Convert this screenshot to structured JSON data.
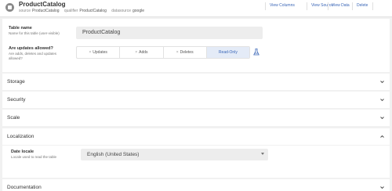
{
  "header": {
    "title": "ProductCatalog",
    "meta": [
      {
        "label": "source",
        "value": "ProductCatalog"
      },
      {
        "label": "qualifier",
        "value": "ProductCatalog"
      },
      {
        "label": "datasource",
        "value": "google"
      }
    ],
    "actions": [
      "View Columns",
      "View Source",
      "View Data",
      "Delete"
    ]
  },
  "form": {
    "table_name": {
      "label": "Table name",
      "sublabel": "Name for this table (user-visible)",
      "value": "ProductCatalog"
    },
    "updates": {
      "label": "Are updates allowed?",
      "sublabel_line1": "Are adds, deletes and updates",
      "sublabel_line2": "allowed?",
      "options": [
        {
          "label": "Updates",
          "active": false
        },
        {
          "label": "Adds",
          "active": false
        },
        {
          "label": "Deletes",
          "active": false
        },
        {
          "label": "Read-Only",
          "active": true
        }
      ]
    }
  },
  "sections": {
    "storage": "Storage",
    "security": "Security",
    "scale": "Scale",
    "localization": "Localization",
    "documentation": "Documentation"
  },
  "localization": {
    "date_locale_label": "Date locale",
    "date_locale_sub": "Locale used to read the table",
    "date_locale_value": "English (United States)"
  },
  "colors": {
    "accent": "#3a66b7",
    "active_bg": "#e4ebf7",
    "page_bg": "#f1f1f1"
  }
}
